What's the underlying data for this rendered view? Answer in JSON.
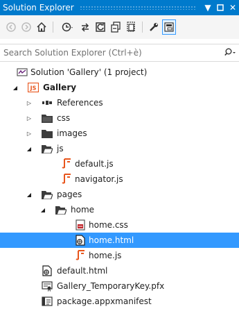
{
  "window": {
    "title": "Solution Explorer",
    "pin_glyph": "▼",
    "pin2_glyph": "▫",
    "close_glyph": "✕"
  },
  "toolbar": {
    "buttons": [
      {
        "name": "back-icon"
      },
      {
        "name": "forward-icon"
      },
      {
        "name": "home-icon"
      },
      {
        "name": "history-icon"
      },
      {
        "name": "sync-icon"
      },
      {
        "name": "refresh-icon"
      },
      {
        "name": "collapse-all-icon"
      },
      {
        "name": "show-all-files-icon"
      },
      {
        "name": "properties-icon"
      },
      {
        "name": "preview-icon"
      }
    ]
  },
  "search": {
    "placeholder": "Search Solution Explorer (Ctrl+è)"
  },
  "tree": {
    "solution": "Solution 'Gallery' (1 project)",
    "project": "Gallery",
    "project_badge": "JS",
    "references": "References",
    "css": "css",
    "images": "images",
    "js": "js",
    "default_js": "default.js",
    "navigator_js": "navigator.js",
    "pages": "pages",
    "home": "home",
    "home_css": "home.css",
    "home_html": "home.html",
    "home_js": "home.js",
    "default_html": "default.html",
    "pfx": "Gallery_TemporaryKey.pfx",
    "manifest": "package.appxmanifest",
    "collapsed_glyph": "▷",
    "expanded_glyph": "◢"
  },
  "colors": {
    "accent": "#007acc",
    "selection": "#3399ff",
    "js_file": "#e8551c",
    "folder": "#3c3c3c"
  }
}
